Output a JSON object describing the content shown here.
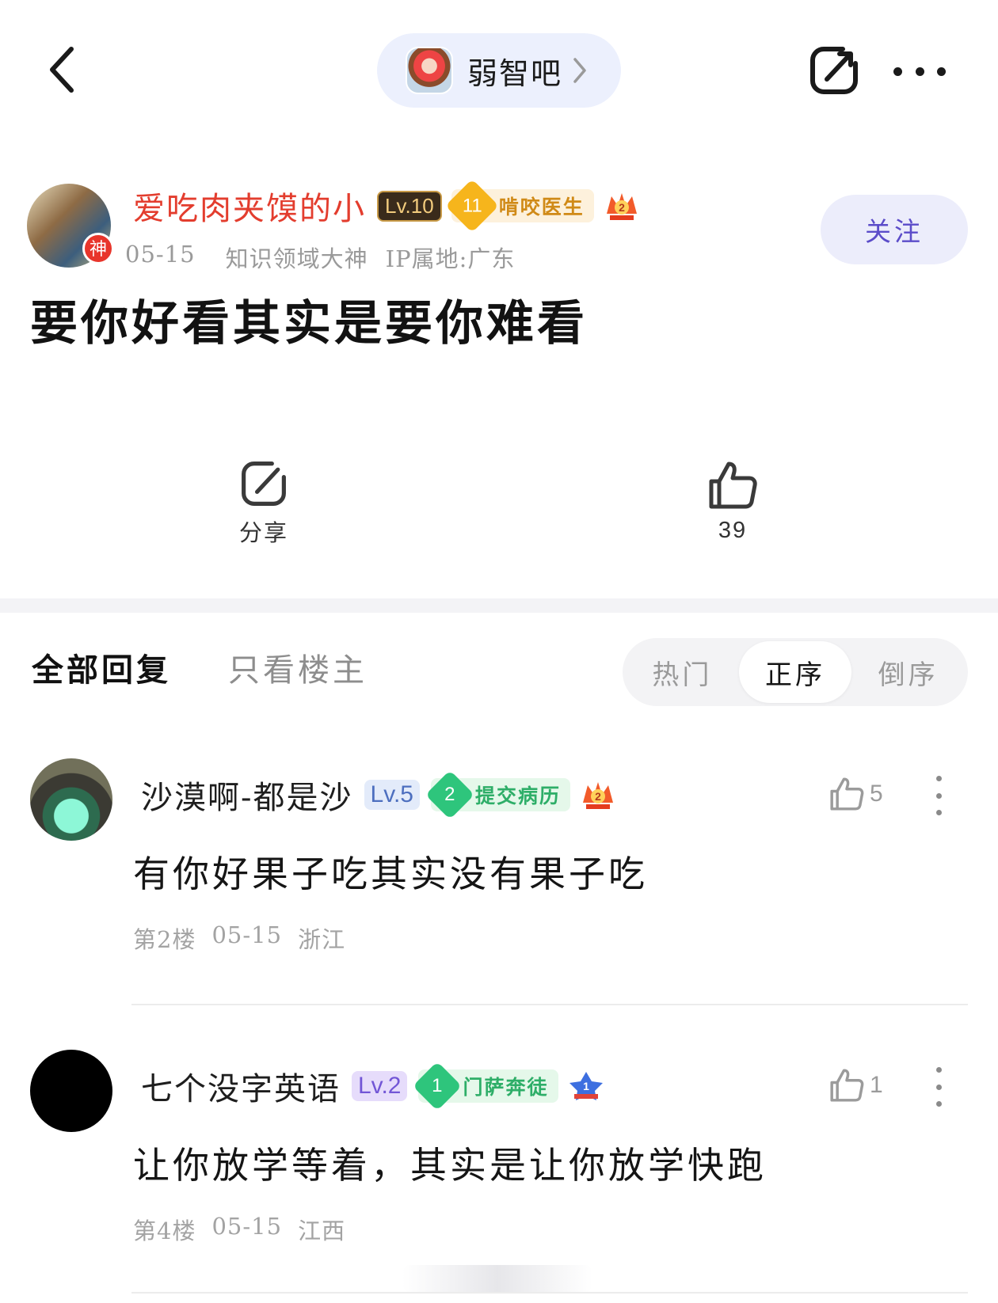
{
  "topbar": {
    "forum_name": "弱智吧",
    "icons": [
      "back-arrow-icon",
      "chevron-right-icon",
      "share-icon",
      "more-icon"
    ]
  },
  "post": {
    "author": {
      "name": "爱吃肉夹馍的小",
      "god_badge": "神",
      "level": "Lv.10",
      "title_level": "11",
      "title": "啃咬医生",
      "extra_badge": "2"
    },
    "date": "05-15",
    "identity": "知识领域大神",
    "ip": "IP属地:广东",
    "follow_label": "关注",
    "title": "要你好看其实是要你难看",
    "share_label": "分享",
    "like_count": "39"
  },
  "filters": {
    "all_replies": "全部回复",
    "op_only": "只看楼主",
    "sort": [
      "热门",
      "正序",
      "倒序"
    ],
    "sort_active": "正序"
  },
  "replies": [
    {
      "name": "沙漠啊-都是沙",
      "level": "Lv.5",
      "title_level": "2",
      "title": "提交病历",
      "extra_badge": "2",
      "likes": "5",
      "content": "有你好果子吃其实没有果子吃",
      "floor": "第2楼",
      "date": "05-15",
      "location": "浙江"
    },
    {
      "name": "七个没字英语",
      "level": "Lv.2",
      "title_level": "1",
      "title": "门萨奔徒",
      "extra_badge": "1",
      "likes": "1",
      "content": "让你放学等着，其实是让你放学快跑",
      "floor": "第4楼",
      "date": "05-15",
      "location": "江西"
    }
  ],
  "colors": {
    "author_name": "#e33d2e",
    "accent_purple": "#5b4cc9",
    "green_badge": "#2ec57c",
    "gold_badge": "#f6b51c"
  }
}
